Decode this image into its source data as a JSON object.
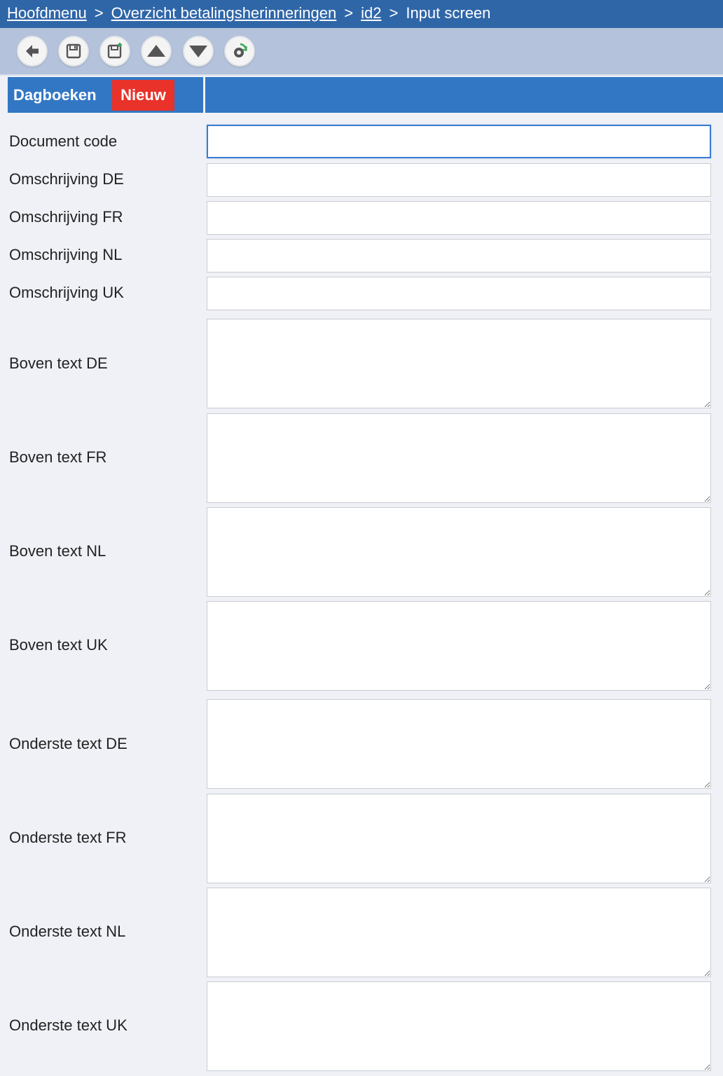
{
  "breadcrumb": {
    "items": [
      "Hoofdmenu",
      "Overzicht betalingsherinneringen",
      "id2"
    ],
    "current": "Input screen",
    "separator": ">"
  },
  "toolbar": {
    "buttons": [
      "back-arrow-icon",
      "save-icon",
      "save-new-icon",
      "arrow-up-icon",
      "arrow-down-icon",
      "refresh-icon"
    ]
  },
  "section": {
    "title": "Dagboeken",
    "badge": "Nieuw"
  },
  "form": {
    "document_code": {
      "label": "Document code",
      "value": ""
    },
    "omschrijving_de": {
      "label": "Omschrijving DE",
      "value": ""
    },
    "omschrijving_fr": {
      "label": "Omschrijving FR",
      "value": ""
    },
    "omschrijving_nl": {
      "label": "Omschrijving NL",
      "value": ""
    },
    "omschrijving_uk": {
      "label": "Omschrijving UK",
      "value": ""
    },
    "boven_text_de": {
      "label": "Boven text DE",
      "value": ""
    },
    "boven_text_fr": {
      "label": "Boven text FR",
      "value": ""
    },
    "boven_text_nl": {
      "label": "Boven text NL",
      "value": ""
    },
    "boven_text_uk": {
      "label": "Boven text UK",
      "value": ""
    },
    "onderste_text_de": {
      "label": "Onderste text DE",
      "value": ""
    },
    "onderste_text_fr": {
      "label": "Onderste text FR",
      "value": ""
    },
    "onderste_text_nl": {
      "label": "Onderste text NL",
      "value": ""
    },
    "onderste_text_uk": {
      "label": "Onderste text UK",
      "value": ""
    }
  },
  "colors": {
    "breadcrumb_bg": "#2f66a8",
    "toolbar_bg": "#b4c3db",
    "section_bg": "#3277c4",
    "badge_bg": "#e8322a",
    "page_bg": "#eff1f6",
    "focus_border": "#3a7cd0"
  }
}
